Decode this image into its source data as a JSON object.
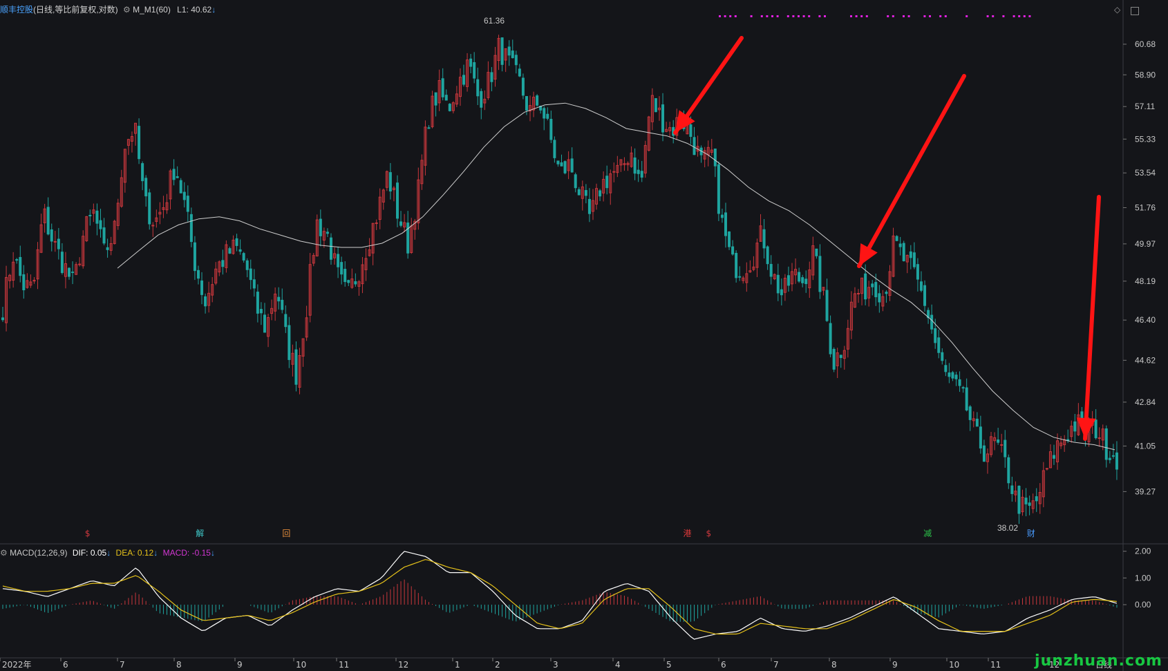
{
  "header": {
    "name": "顺丰控股",
    "mode": "(日线,等比前复权,对数)",
    "indicator": "M_M1(60)",
    "indicator_value": "L1: 40.62",
    "arrow": "↓"
  },
  "macd_header": {
    "name": "MACD(12,26,9)",
    "dif_label": "DIF: 0.05",
    "dea_label": "DEA: 0.12",
    "macd_label": "MACD: -0.15",
    "arrow": "↓"
  },
  "watermark": "junzhuan.com",
  "colors": {
    "background": "#141519",
    "up": "#c8373c",
    "down": "#1fa5a0",
    "ma": "#cfcfcf",
    "dif": "#ffffff",
    "dea": "#e6c21a",
    "macd_label": "#d236d2",
    "annotation_arrow": "#ff1414",
    "event_markers": "#e020e0"
  },
  "chart_data": [
    {
      "type": "candlestick",
      "title": "顺丰控股",
      "ylim": [
        37.5,
        62.5
      ],
      "y_scale": "log",
      "y_ticks": [
        "60.68",
        "58.90",
        "57.11",
        "55.33",
        "53.54",
        "51.76",
        "49.97",
        "48.19",
        "46.40",
        "44.62",
        "42.84",
        "41.05",
        "39.27"
      ],
      "x_labels": [
        "2022年",
        "6",
        "7",
        "8",
        "9",
        "10",
        "11",
        "12",
        "1",
        "2",
        "3",
        "4",
        "5",
        "6",
        "7",
        "8",
        "9",
        "10",
        "11",
        "12",
        "日线"
      ],
      "price_path": [
        47,
        49.5,
        48,
        47.8,
        51.5,
        50,
        49,
        48,
        50.5,
        51.5,
        49.5,
        50.5,
        55,
        56,
        52,
        51,
        52,
        54,
        51.8,
        49,
        47.2,
        48.7,
        49.4,
        49.8,
        49,
        47,
        46,
        48,
        45.5,
        44,
        47,
        51,
        50.5,
        48.5,
        47.5,
        48.5,
        50,
        51.5,
        53.5,
        51.5,
        50,
        52.5,
        56.5,
        58,
        57,
        58.5,
        59.5,
        57.5,
        58.5,
        60.5,
        59.5,
        58.5,
        56.8,
        57.5,
        55.5,
        53.5,
        54,
        52.5,
        51.2,
        52.8,
        53.5,
        53.6,
        54.8,
        52.8,
        57.5,
        56.5,
        55.8,
        56.5,
        55.5,
        54,
        54.5,
        51,
        49,
        48.8,
        49.3,
        50.5,
        48.5,
        47.5,
        48.5,
        48.2,
        49.5,
        47.5,
        44.5,
        45.3,
        47.5,
        47.8,
        48.2,
        47.5,
        50,
        49.2,
        48.5,
        47.3,
        45.5,
        44,
        43.5,
        42.8,
        41.5,
        40.8,
        41.2,
        40.3,
        39,
        38.5,
        38.8,
        40,
        41,
        41.5,
        42,
        41.5,
        41.8,
        41,
        40.62
      ],
      "ma_label": "M_M1(60)",
      "ma_path": [
        48.8,
        49.6,
        50.4,
        50.9,
        51.2,
        51.3,
        51.1,
        50.7,
        50.4,
        50.1,
        49.9,
        49.8,
        49.8,
        50,
        50.5,
        51.3,
        52.4,
        53.6,
        54.9,
        56,
        56.8,
        57.2,
        57.3,
        57,
        56.5,
        55.9,
        55.7,
        55.5,
        55.1,
        54.5,
        53.7,
        52.8,
        52.1,
        51.6,
        50.9,
        50.1,
        49.3,
        48.5,
        47.8,
        47.2,
        46.4,
        45.4,
        44.3,
        43.3,
        42.5,
        41.8,
        41.4,
        41.2,
        41.1,
        40.9
      ],
      "high_label": "61.36",
      "low_label": "38.02",
      "event_markers": [
        {
          "label": "$",
          "x_pos": 0.078,
          "color": "#d0393e"
        },
        {
          "label": "解",
          "x_pos": 0.178,
          "color": "#3fc9c9"
        },
        {
          "label": "回",
          "x_pos": 0.255,
          "color": "#e08a3a"
        },
        {
          "label": "港",
          "x_pos": 0.612,
          "color": "#e03a3a"
        },
        {
          "label": "$",
          "x_pos": 0.631,
          "color": "#d0393e"
        },
        {
          "label": "减",
          "x_pos": 0.826,
          "color": "#2cc44a"
        },
        {
          "label": "财",
          "x_pos": 0.918,
          "color": "#4a9cff"
        }
      ]
    },
    {
      "type": "macd",
      "title": "MACD(12,26,9)",
      "ylim": [
        -1.6,
        2.2
      ],
      "y_ticks": [
        "2.00",
        "1.00",
        "0.00"
      ],
      "dif": [
        0.6,
        0.5,
        0.3,
        0.6,
        0.9,
        0.7,
        1.4,
        0.3,
        -0.5,
        -1.0,
        -0.5,
        -0.4,
        -0.8,
        -0.2,
        0.3,
        0.6,
        0.5,
        1.0,
        2.0,
        1.8,
        1.2,
        1.2,
        0.5,
        -0.4,
        -0.9,
        -0.9,
        -0.6,
        0.5,
        0.8,
        0.5,
        -0.5,
        -1.3,
        -1.1,
        -1.0,
        -0.5,
        -0.9,
        -1.0,
        -0.8,
        -0.5,
        -0.1,
        0.3,
        -0.3,
        -0.9,
        -1.0,
        -1.1,
        -1.0,
        -0.5,
        -0.2,
        0.2,
        0.3,
        0.05
      ],
      "dea": [
        0.7,
        0.5,
        0.5,
        0.6,
        0.8,
        0.8,
        1.1,
        0.5,
        -0.2,
        -0.6,
        -0.5,
        -0.4,
        -0.6,
        -0.3,
        0.1,
        0.4,
        0.5,
        0.8,
        1.4,
        1.7,
        1.4,
        1.2,
        0.7,
        0.0,
        -0.7,
        -0.9,
        -0.7,
        0.2,
        0.6,
        0.6,
        -0.1,
        -0.9,
        -1.1,
        -1.1,
        -0.7,
        -0.8,
        -0.9,
        -0.9,
        -0.6,
        -0.2,
        0.2,
        -0.1,
        -0.6,
        -1.0,
        -1.0,
        -1.0,
        -0.7,
        -0.4,
        0.1,
        0.2,
        0.12
      ]
    }
  ]
}
